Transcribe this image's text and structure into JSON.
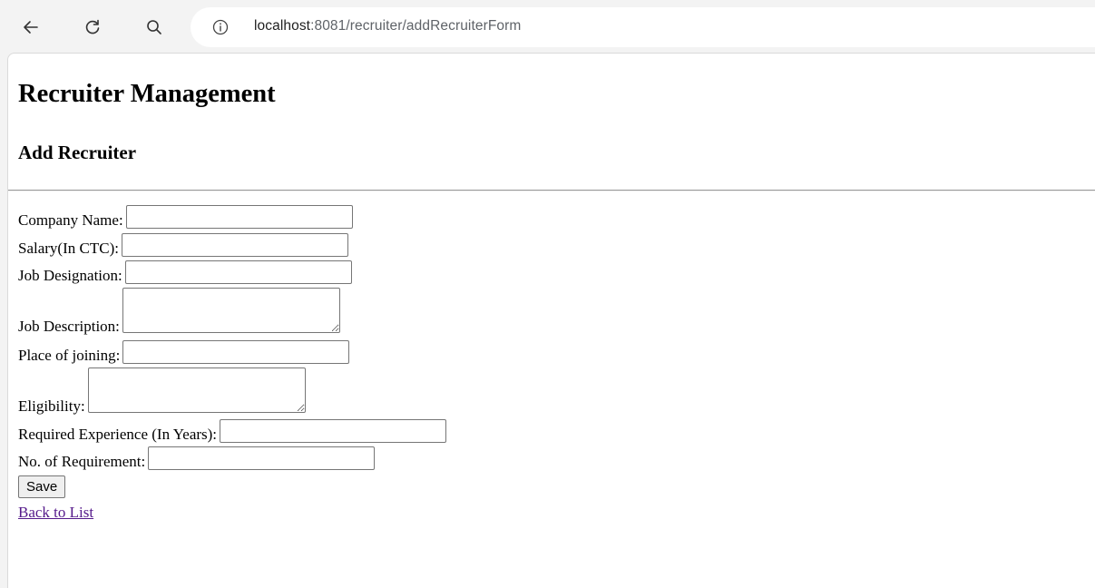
{
  "browser": {
    "url_host": "localhost",
    "url_rest": ":8081/recruiter/addRecruiterForm",
    "back_icon": "arrow-left-icon",
    "reload_icon": "reload-icon",
    "search_icon": "search-icon",
    "info_icon": "info-icon"
  },
  "page": {
    "title": "Recruiter Management",
    "subtitle": "Add Recruiter"
  },
  "form": {
    "company_name_label": "Company Name:",
    "salary_label": "Salary(In CTC):",
    "job_designation_label": "Job Designation:",
    "job_description_label": "Job Description:",
    "place_of_joining_label": "Place of joining:",
    "eligibility_label": "Eligibility:",
    "required_experience_label": "Required Experience (In Years):",
    "no_of_requirement_label": "No. of Requirement:",
    "company_name_value": "",
    "salary_value": "",
    "job_designation_value": "",
    "job_description_value": "",
    "place_of_joining_value": "",
    "eligibility_value": "",
    "required_experience_value": "",
    "no_of_requirement_value": "",
    "save_label": "Save",
    "back_link_label": "Back to List"
  }
}
